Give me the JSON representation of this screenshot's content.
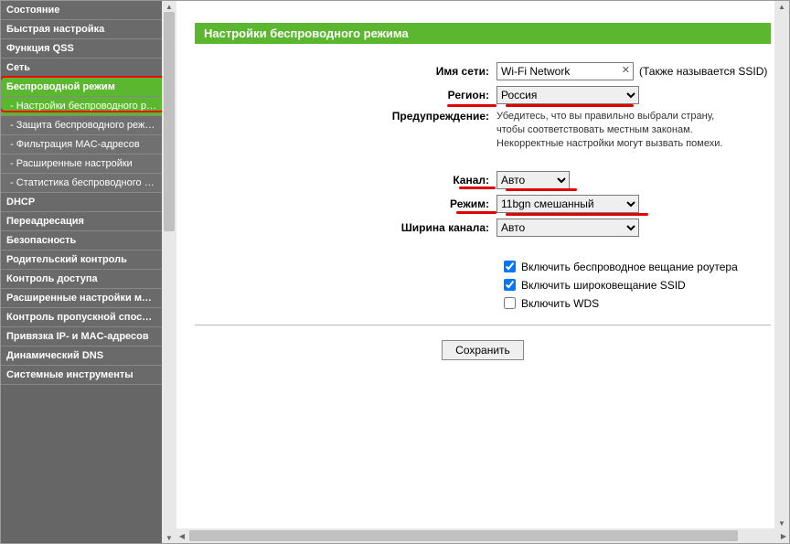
{
  "sidebar": {
    "items": [
      {
        "label": "Состояние",
        "type": "main"
      },
      {
        "label": "Быстрая настройка",
        "type": "main"
      },
      {
        "label": "Функция QSS",
        "type": "main"
      },
      {
        "label": "Сеть",
        "type": "main"
      },
      {
        "label": "Беспроводной режим",
        "type": "main",
        "active": true
      },
      {
        "label": "- Настройки беспроводного режима",
        "type": "sub",
        "activeSub": true
      },
      {
        "label": "- Защита беспроводного режима",
        "type": "sub"
      },
      {
        "label": "- Фильтрация MAC-адресов",
        "type": "sub"
      },
      {
        "label": "- Расширенные настройки",
        "type": "sub"
      },
      {
        "label": "- Статистика беспроводного режима",
        "type": "sub"
      },
      {
        "label": "DHCP",
        "type": "main"
      },
      {
        "label": "Переадресация",
        "type": "main"
      },
      {
        "label": "Безопасность",
        "type": "main"
      },
      {
        "label": "Родительский контроль",
        "type": "main"
      },
      {
        "label": "Контроль доступа",
        "type": "main"
      },
      {
        "label": "Расширенные настройки маршрутизац",
        "type": "main"
      },
      {
        "label": "Контроль пропускной способности",
        "type": "main"
      },
      {
        "label": "Привязка IP- и MAC-адресов",
        "type": "main"
      },
      {
        "label": "Динамический DNS",
        "type": "main"
      },
      {
        "label": "Системные инструменты",
        "type": "main"
      }
    ]
  },
  "page": {
    "title": "Настройки беспроводного режима",
    "labels": {
      "ssid": "Имя сети:",
      "region": "Регион:",
      "warning": "Предупреждение:",
      "channel": "Канал:",
      "mode": "Режим:",
      "channel_width": "Ширина канала:"
    },
    "values": {
      "ssid": "Wi-Fi Network",
      "region": "Россия",
      "channel": "Авто",
      "mode": "11bgn смешанный",
      "channel_width": "Авто"
    },
    "ssid_hint": "(Также называется SSID)",
    "warning_text_1": "Убедитесь, что вы правильно выбрали страну,",
    "warning_text_2": "чтобы соответствовать местным законам.",
    "warning_text_3": "Некорректные настройки могут вызвать помехи.",
    "checkboxes": {
      "enable_radio": {
        "label": "Включить беспроводное вещание роутера",
        "checked": true
      },
      "enable_ssid_broadcast": {
        "label": "Включить широковещание SSID",
        "checked": true
      },
      "enable_wds": {
        "label": "Включить WDS",
        "checked": false
      }
    },
    "save_button": "Сохранить"
  }
}
